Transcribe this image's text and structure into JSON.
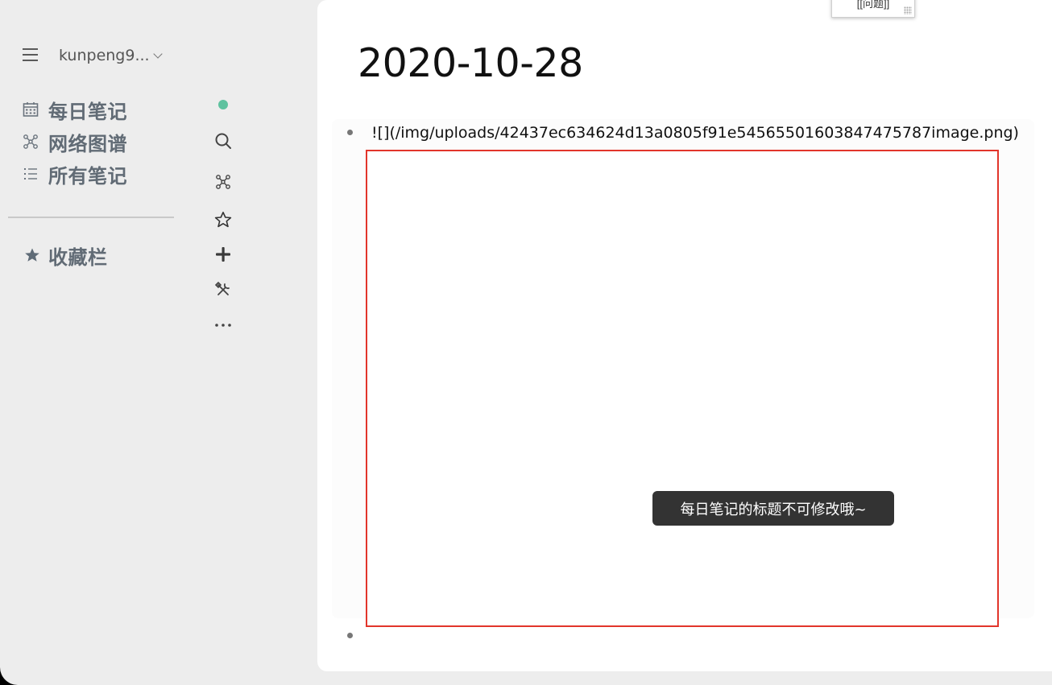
{
  "sidebar": {
    "user": {
      "name": "kunpeng9..."
    },
    "nav": [
      {
        "label": "每日笔记",
        "icon": "calendar-icon"
      },
      {
        "label": "网络图谱",
        "icon": "graph-icon"
      },
      {
        "label": "所有笔记",
        "icon": "list-icon"
      }
    ],
    "favorites": {
      "label": "收藏栏",
      "icon": "star-filled-icon"
    }
  },
  "rail": {
    "icons": [
      "sync-status-dot",
      "search-icon",
      "graph-icon",
      "star-outline-icon",
      "plus-icon",
      "tools-icon",
      "more-icon"
    ],
    "status_color": "#5ec29f"
  },
  "main": {
    "title": "2020-10-28",
    "blocks": [
      {
        "text": "![](/img/uploads/42437ec634624d13a0805f91e54565501603847475787image.png)"
      },
      {
        "text": ""
      }
    ],
    "toast": "每日笔记的标题不可修改哦~",
    "popup_text": "[[问题]]",
    "accent_border": "#e2352b"
  }
}
